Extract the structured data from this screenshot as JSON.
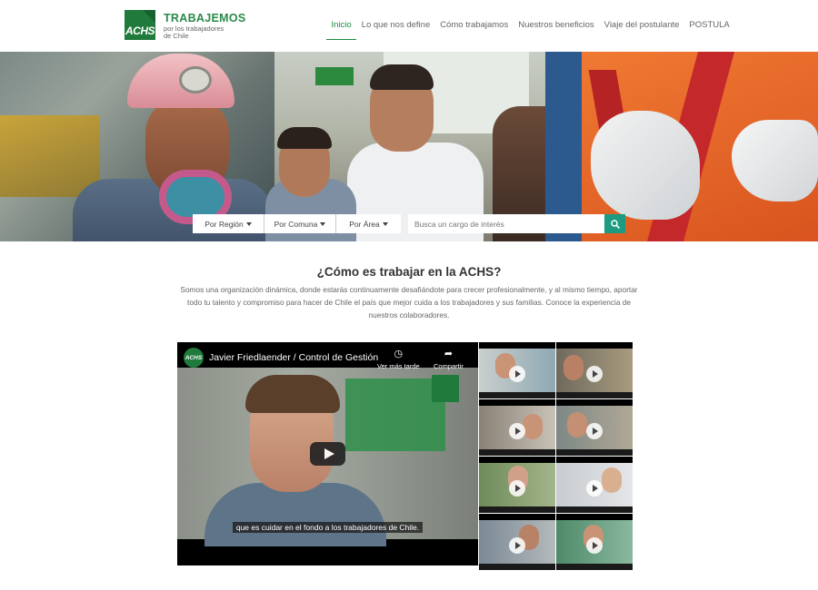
{
  "header": {
    "logo_mark": "ACHS",
    "brand_title": "TRABAJEMOS",
    "brand_sub_line1": "por los trabajadores",
    "brand_sub_line2": "de Chile",
    "nav": [
      {
        "label": "Inicio",
        "active": true
      },
      {
        "label": "Lo que nos define",
        "active": false
      },
      {
        "label": "Cómo trabajamos",
        "active": false
      },
      {
        "label": "Nuestros beneficios",
        "active": false
      },
      {
        "label": "Viaje del postulante",
        "active": false
      },
      {
        "label": "POSTULA",
        "active": false
      }
    ]
  },
  "search": {
    "filters": [
      "Por Región",
      "Por Comuna",
      "Por Área"
    ],
    "placeholder": "Busca un cargo de interés",
    "button_icon": "search-icon"
  },
  "section": {
    "title": "¿Cómo es trabajar en la ACHS?",
    "description": "Somos una organización dinámica, donde estarás continuamente desafiándote para crecer profesionalmente, y al mismo tiempo, aportar todo tu talento y compromiso para hacer de Chile el país que mejor cuida a los trabajadores y sus familias. Conoce la experiencia de nuestros colaboradores."
  },
  "video": {
    "channel_badge": "ACHS",
    "title": "Javier Friedlaender / Control de Gestión",
    "watch_later": "Ver más tarde",
    "share": "Compartir",
    "subtitle": "que es cuidar en el fondo a los trabajadores de Chile.",
    "watermark": "ACHS"
  },
  "thumbnails": {
    "count_label": "",
    "items": [
      {
        "name": "video-thumb-1"
      },
      {
        "name": "video-thumb-2"
      },
      {
        "name": "video-thumb-3"
      },
      {
        "name": "video-thumb-4"
      },
      {
        "name": "video-thumb-5"
      },
      {
        "name": "video-thumb-6"
      },
      {
        "name": "video-thumb-7"
      },
      {
        "name": "video-thumb-8"
      }
    ]
  },
  "colors": {
    "brand_green": "#1f7a3c",
    "accent_teal": "#1c9a82",
    "nav_active": "#1b8a3f"
  }
}
